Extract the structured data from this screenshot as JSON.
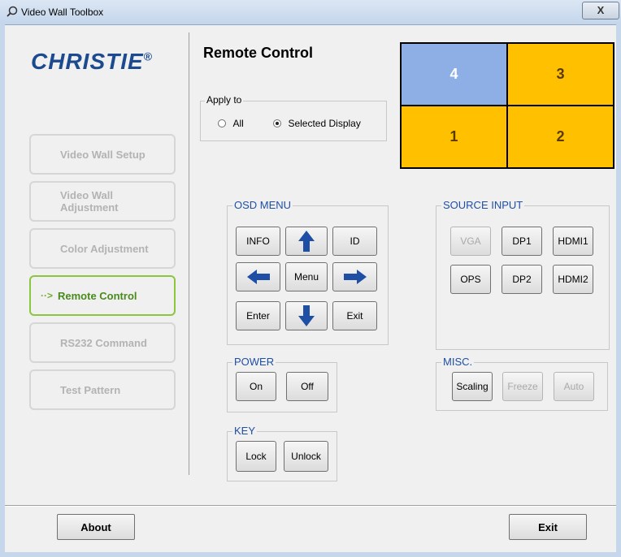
{
  "window": {
    "title": "Video Wall Toolbox",
    "close_glyph": "X"
  },
  "brand": {
    "logo_text": "CHRISTIE",
    "logo_mark": "®"
  },
  "sidebar": {
    "items": [
      {
        "label": "Video Wall Setup",
        "active": false
      },
      {
        "label": "Video Wall Adjustment",
        "active": false
      },
      {
        "label": "Color Adjustment",
        "active": false
      },
      {
        "label": "Remote Control",
        "active": true,
        "marker": "··>"
      },
      {
        "label": "RS232 Command",
        "active": false
      },
      {
        "label": "Test Pattern",
        "active": false
      }
    ]
  },
  "main": {
    "title": "Remote Control",
    "apply_to": {
      "label": "Apply to",
      "options": [
        {
          "label": "All",
          "selected": false
        },
        {
          "label": "Selected Display",
          "selected": true
        }
      ]
    },
    "display_grid": {
      "tiles": [
        {
          "label": "4",
          "color": "#8eaee6"
        },
        {
          "label": "3",
          "color": "#ffc000"
        },
        {
          "label": "1",
          "color": "#ffc000"
        },
        {
          "label": "2",
          "color": "#ffc000"
        }
      ]
    },
    "osd_menu": {
      "label": "OSD MENU",
      "info": "INFO",
      "id": "ID",
      "menu": "Menu",
      "enter": "Enter",
      "exit": "Exit",
      "arrow_color": "#1f4ea5"
    },
    "source_input": {
      "label": "SOURCE INPUT",
      "buttons": [
        {
          "label": "VGA",
          "enabled": false
        },
        {
          "label": "DP1",
          "enabled": true
        },
        {
          "label": "HDMI1",
          "enabled": true
        },
        {
          "label": "OPS",
          "enabled": true
        },
        {
          "label": "DP2",
          "enabled": true
        },
        {
          "label": "HDMI2",
          "enabled": true
        }
      ]
    },
    "power": {
      "label": "POWER",
      "on": "On",
      "off": "Off"
    },
    "misc": {
      "label": "MISC.",
      "buttons": [
        {
          "label": "Scaling",
          "enabled": true
        },
        {
          "label": "Freeze",
          "enabled": false
        },
        {
          "label": "Auto",
          "enabled": false
        }
      ]
    },
    "key": {
      "label": "KEY",
      "lock": "Lock",
      "unlock": "Unlock"
    }
  },
  "footer": {
    "about": "About",
    "exit": "Exit"
  }
}
